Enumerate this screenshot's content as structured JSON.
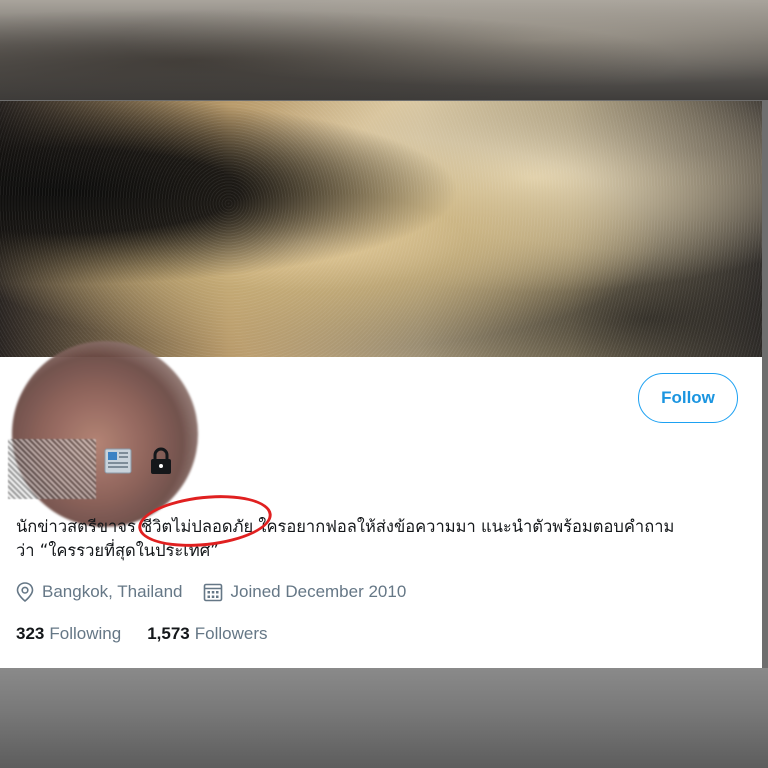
{
  "profile": {
    "follow_label": "Follow",
    "bio_line1": "นักข่าวสตรีขาจร ชีวิตไม่ปลอดภัย ใครอยากฟอลให้ส่งข้อความมา แนะนำตัวพร้อมตอบคำถาม",
    "bio_line2": "ว่า “ใครรวยที่สุดในประเทศ”",
    "location": "Bangkok, Thailand",
    "joined": "Joined December 2010",
    "following_count": "323",
    "following_label": "Following",
    "followers_count": "1,573",
    "followers_label": "Followers"
  },
  "icons": {
    "location": "location-pin-icon",
    "calendar": "calendar-icon",
    "news": "newspaper-emoji-icon",
    "lock": "lock-icon"
  },
  "colors": {
    "follow_accent": "#1da1f2",
    "muted_text": "#657786",
    "annotation_circle": "#e02020"
  }
}
